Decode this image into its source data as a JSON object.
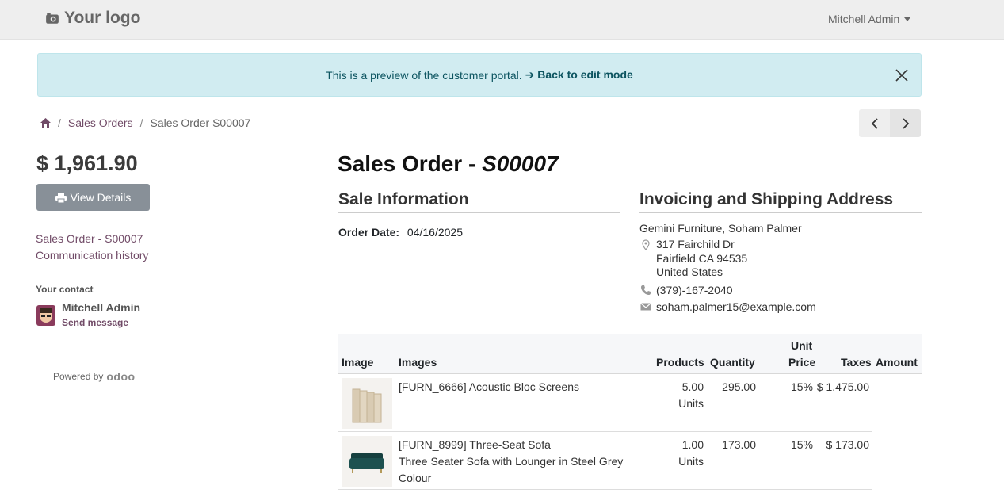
{
  "header": {
    "logo_text": "Your logo",
    "user_name": "Mitchell Admin"
  },
  "alert": {
    "message": "This is a preview of the customer portal.",
    "back_link": "➔ Back to edit mode"
  },
  "breadcrumb": {
    "items": [
      "Sales Orders",
      "Sales Order S00007"
    ]
  },
  "sidebar": {
    "amount": "$ 1,961.90",
    "view_details": "View Details",
    "links": [
      "Sales Order - S00007",
      "Communication history"
    ],
    "contact_label": "Your contact",
    "contact_name": "Mitchell Admin",
    "send_message": "Send message",
    "powered_by": "Powered by",
    "powered_brand": "odoo"
  },
  "main": {
    "title_prefix": "Sales Order - ",
    "title_ref": "S00007",
    "sale_info_heading": "Sale Information",
    "order_date_label": "Order Date:",
    "order_date_value": "04/16/2025",
    "address_heading": "Invoicing and Shipping Address",
    "address": {
      "name": "Gemini Furniture, Soham Palmer",
      "street": "317 Fairchild Dr",
      "city": "Fairfield CA 94535",
      "country": "United States",
      "phone": "(379)-167-2040",
      "email": "soham.palmer15@example.com"
    }
  },
  "table": {
    "headers": {
      "image": "Image",
      "images": "Images",
      "products": "Products",
      "quantity": "Quantity",
      "unit": "Unit",
      "price": "Price",
      "taxes": "Taxes",
      "amount": "Amount"
    },
    "rows": [
      {
        "name": "[FURN_6666] Acoustic Bloc Screens",
        "description": "",
        "description2": "",
        "qty": "5.00",
        "uom": "Units",
        "unit_price": "295.00",
        "taxes": "15%",
        "amount": "$ 1,475.00"
      },
      {
        "name": "[FURN_8999] Three-Seat Sofa",
        "description": "Three Seater Sofa with Lounger in Steel Grey",
        "description2": "Colour",
        "qty": "1.00",
        "uom": "Units",
        "unit_price": "173.00",
        "taxes": "15%",
        "amount": "$ 173.00"
      }
    ]
  },
  "colors": {
    "brand": "#714b67",
    "alert_bg": "#d1ecf1",
    "alert_text": "#0c5460",
    "button_gray": "#889098"
  }
}
